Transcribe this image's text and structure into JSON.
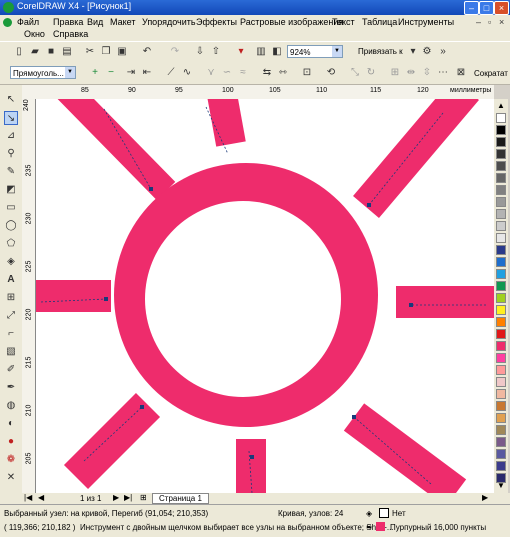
{
  "window": {
    "title": "CorelDRAW X4 - [Рисунок1]"
  },
  "menu": [
    "Файл",
    "Правка",
    "Вид",
    "Макет",
    "Упорядочить",
    "Эффекты",
    "Растровые изображения",
    "Текст",
    "Таблица",
    "Инструменты",
    "Окно",
    "Справка"
  ],
  "toolbar1": {
    "zoom": "924%",
    "snap": "Привязать к"
  },
  "toolbar2": {
    "shape_select": "Прямоуголь...",
    "reduce": "Сократат"
  },
  "ruler": {
    "h_ticks": [
      "85",
      "90",
      "95",
      "100",
      "105",
      "110",
      "115",
      "120"
    ],
    "h_unit": "миллиметры",
    "v_ticks": [
      "240",
      "235",
      "230",
      "225",
      "220",
      "215",
      "210",
      "205"
    ],
    "v_unit": "миллиметры"
  },
  "pager": {
    "count": "1 из 1",
    "tab": "Страница 1"
  },
  "status": {
    "selected": "Выбранный узел: на кривой, Перегиб (91,054; 210,353)",
    "curve": "Кривая, узлов: 24",
    "fill_none": "Нет",
    "coords": "( 119,366; 210,182 )",
    "hint": "Инструмент с двойным щелчком выбирает все узлы на выбранном объекте; Shift+...",
    "outline": "Пурпурный  16,000 пункты"
  },
  "colors": {
    "shape": "#ee2c6c",
    "palette": [
      "#ffffff",
      "#000000",
      "#1a1a1a",
      "#333333",
      "#4d4d4d",
      "#666666",
      "#808080",
      "#999999",
      "#b3b3b3",
      "#cccccc",
      "#e6e6e6",
      "#2a3a8a",
      "#1e6ecc",
      "#20a0e0",
      "#109850",
      "#a0d020",
      "#fff020",
      "#ff8000",
      "#e01818",
      "#ee2c6c",
      "#ff3fa0",
      "#ff9a9a",
      "#f0c8c8",
      "#f0b8a0",
      "#c87830",
      "#e0a050",
      "#a08858",
      "#7a5a8a",
      "#5a5aa0",
      "#3c3c8c",
      "#2a2a6c"
    ]
  }
}
